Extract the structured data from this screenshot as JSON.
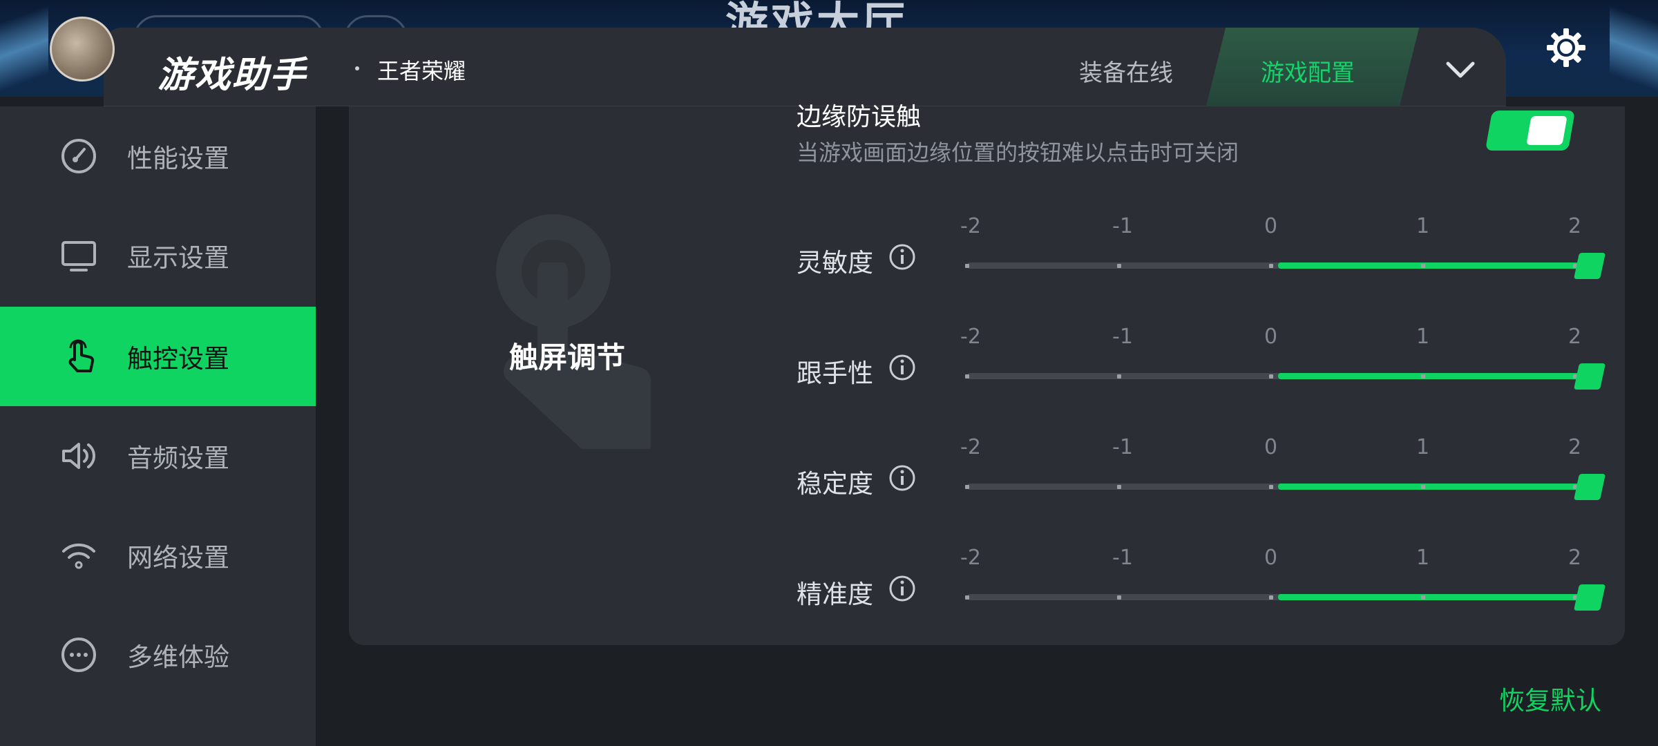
{
  "backdrop": {
    "ghost_title": "游戏大厅"
  },
  "header": {
    "app_title": "游戏助手",
    "game_name": "王者荣耀",
    "tabs": [
      {
        "label": "装备在线",
        "active": false
      },
      {
        "label": "游戏配置",
        "active": true
      }
    ],
    "chevron_icon": "chevron-down-icon",
    "settings_icon": "gear-icon"
  },
  "sidebar": {
    "items": [
      {
        "label": "性能设置",
        "icon": "gauge-icon",
        "active": false
      },
      {
        "label": "显示设置",
        "icon": "monitor-icon",
        "active": false
      },
      {
        "label": "触控设置",
        "icon": "touch-hand-icon",
        "active": true
      },
      {
        "label": "音频设置",
        "icon": "speaker-icon",
        "active": false
      },
      {
        "label": "网络设置",
        "icon": "wifi-icon",
        "active": false
      },
      {
        "label": "多维体验",
        "icon": "more-dots-icon",
        "active": false
      }
    ]
  },
  "panel": {
    "hero_title": "触屏调节",
    "edge": {
      "title": "边缘防误触",
      "description": "当游戏画面边缘位置的按钮难以点击时可关闭",
      "enabled": true
    },
    "scale_ticks": [
      "-2",
      "-1",
      "0",
      "1",
      "2"
    ],
    "sliders": [
      {
        "label": "灵敏度",
        "value": 2
      },
      {
        "label": "跟手性",
        "value": 2
      },
      {
        "label": "稳定度",
        "value": 2
      },
      {
        "label": "精准度",
        "value": 2
      }
    ]
  },
  "footer": {
    "restore_label": "恢复默认"
  },
  "colors": {
    "accent": "#0fd462",
    "panel": "#2b2f35",
    "background": "#1c1f23"
  }
}
